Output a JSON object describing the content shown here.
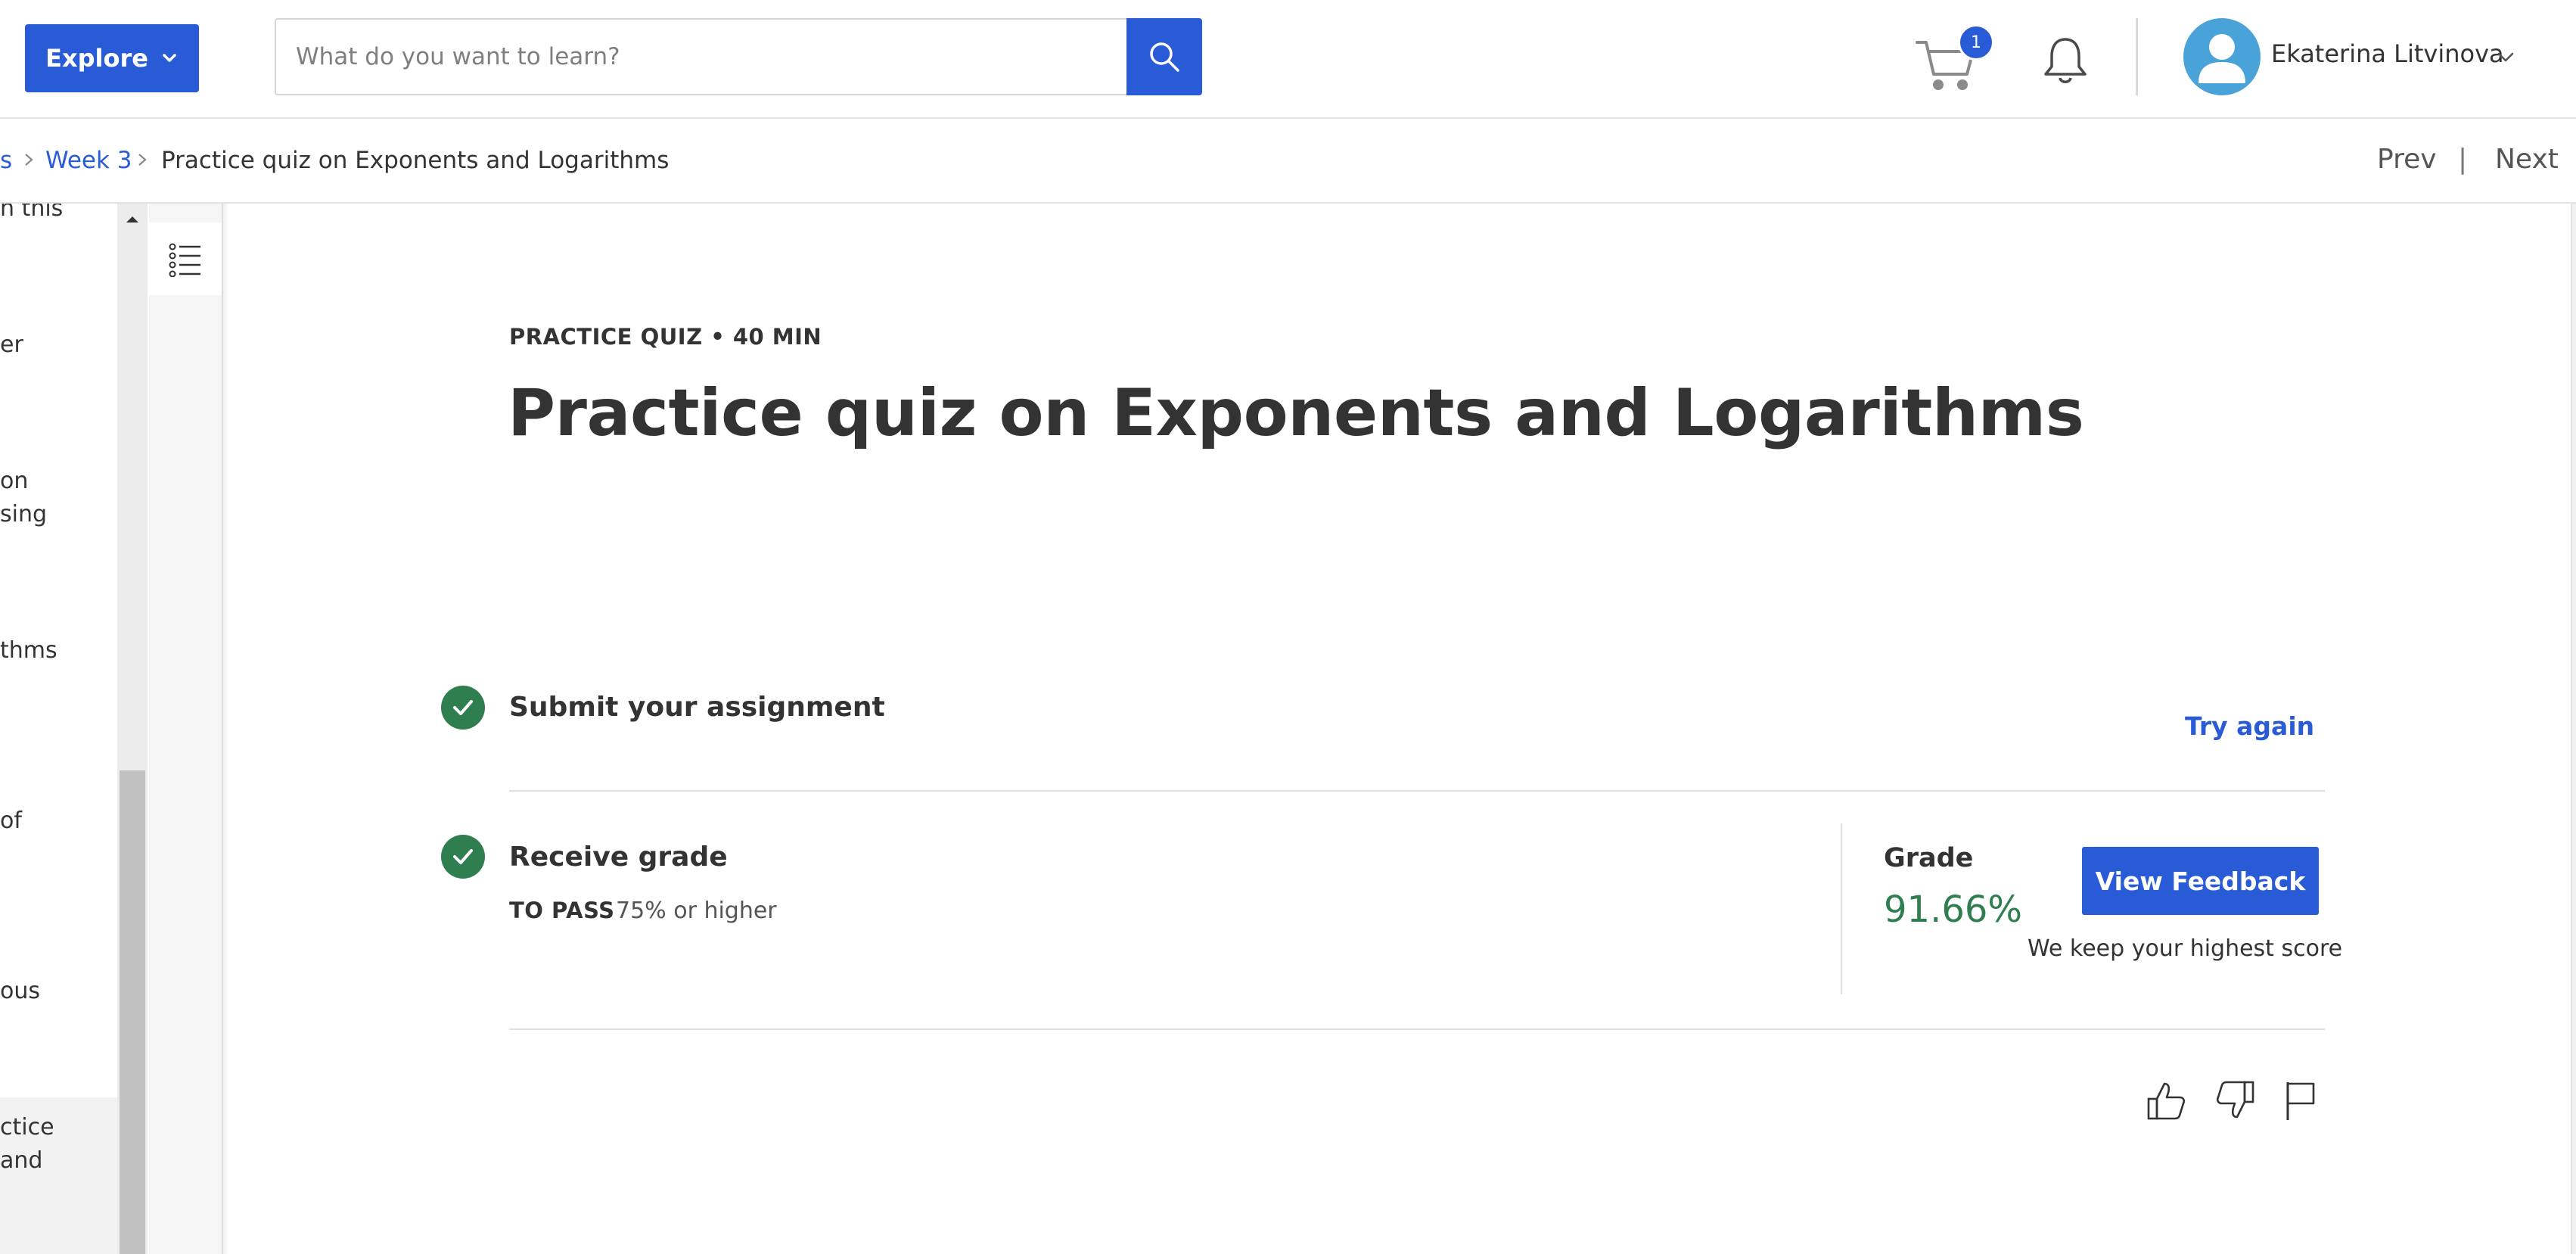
{
  "header": {
    "explore_label": "Explore",
    "search_placeholder": "What do you want to learn?",
    "cart_count": "1",
    "user_name": "Ekaterina Litvinova"
  },
  "breadcrumb": {
    "partial_item": "s",
    "week_link": "Week 3",
    "current": "Practice quiz on Exponents and Logarithms",
    "prev_label": "Prev",
    "separator": "|",
    "next_label": "Next"
  },
  "sidebar": {
    "fragments": [
      "n this",
      "er",
      "on",
      "sing",
      "thms",
      "of",
      "ous",
      "ctice",
      "and"
    ]
  },
  "main": {
    "eyebrow": "PRACTICE QUIZ • 40 MIN",
    "title": "Practice quiz on Exponents and Logarithms",
    "step_submit": "Submit your assignment",
    "try_again_label": "Try again",
    "step_grade": "Receive grade",
    "to_pass_label": "TO PASS",
    "to_pass_value": "75% or higher",
    "grade_label": "Grade",
    "grade_value": "91.66%",
    "view_feedback_label": "View Feedback",
    "keep_score_note": "We keep your highest score"
  },
  "colors": {
    "brand_blue": "#2a5bd7",
    "success_green": "#2f7e4f",
    "avatar_bg": "#4aa3d8"
  },
  "icons": {
    "explore_chevron": "chevron-down-icon",
    "search": "search-icon",
    "cart": "cart-icon",
    "notifications": "bell-icon",
    "avatar": "user-avatar-icon",
    "user_menu": "chevron-down-icon",
    "outline": "list-icon",
    "completed": "check-icon",
    "like": "thumbs-up-icon",
    "dislike": "thumbs-down-icon",
    "report": "flag-icon"
  }
}
